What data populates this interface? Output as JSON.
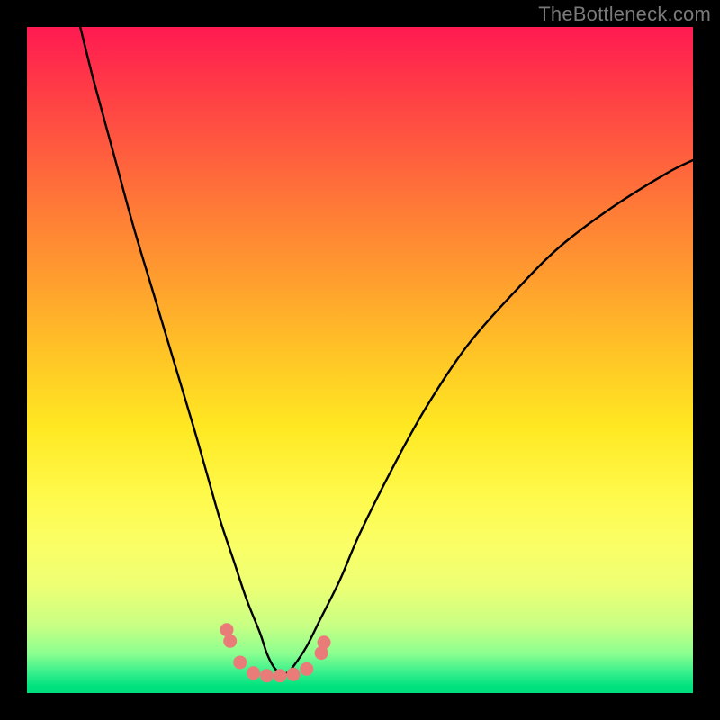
{
  "watermark": "TheBottleneck.com",
  "chart_data": {
    "type": "line",
    "title": "",
    "xlabel": "",
    "ylabel": "",
    "xlim": [
      0,
      100
    ],
    "ylim": [
      0,
      100
    ],
    "grid": false,
    "series": [
      {
        "name": "bottleneck-curve",
        "x": [
          8,
          10,
          13,
          16,
          19,
          22,
          25,
          27,
          29,
          31,
          33,
          35,
          36,
          37,
          38,
          39,
          40,
          42,
          44,
          47,
          50,
          55,
          60,
          66,
          73,
          80,
          88,
          96,
          100
        ],
        "y": [
          100,
          92,
          81,
          70,
          60,
          50,
          40,
          33,
          26,
          20,
          14,
          9,
          6,
          4,
          3,
          3,
          4,
          7,
          11,
          17,
          24,
          34,
          43,
          52,
          60,
          67,
          73,
          78,
          80
        ]
      }
    ],
    "markers": {
      "name": "data-points",
      "x": [
        30.0,
        30.5,
        32.0,
        34.0,
        36.0,
        38.0,
        40.0,
        42.0,
        44.2,
        44.6
      ],
      "y": [
        9.5,
        7.8,
        4.6,
        3.0,
        2.6,
        2.6,
        2.8,
        3.6,
        6.0,
        7.6
      ]
    },
    "gradient_stops": [
      {
        "pos": 0,
        "color": "#ff1a52"
      },
      {
        "pos": 50,
        "color": "#ffd024"
      },
      {
        "pos": 100,
        "color": "#00de7c"
      }
    ]
  }
}
